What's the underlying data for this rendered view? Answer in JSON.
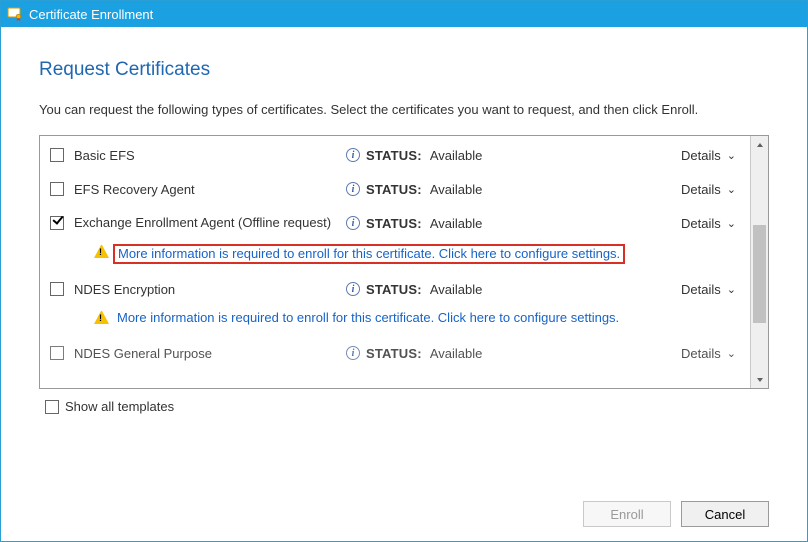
{
  "titlebar": {
    "title": "Certificate Enrollment"
  },
  "page": {
    "heading": "Request Certificates",
    "subtext": "You can request the following types of certificates. Select the certificates you want to request, and then click Enroll."
  },
  "labels": {
    "status_label": "STATUS:",
    "details": "Details",
    "show_all": "Show all templates",
    "enroll": "Enroll",
    "cancel": "Cancel"
  },
  "warning_text": "More information is required to enroll for this certificate. Click here to configure settings.",
  "certs": [
    {
      "name": "Basic EFS",
      "status": "Available",
      "checked": false,
      "warn": false
    },
    {
      "name": "EFS Recovery Agent",
      "status": "Available",
      "checked": false,
      "warn": false
    },
    {
      "name": "Exchange Enrollment Agent (Offline request)",
      "status": "Available",
      "checked": true,
      "warn": true,
      "highlight": true
    },
    {
      "name": "NDES Encryption",
      "status": "Available",
      "checked": false,
      "warn": true
    },
    {
      "name": "NDES General Purpose",
      "status": "Available",
      "checked": false,
      "warn": false,
      "cut": true
    }
  ]
}
